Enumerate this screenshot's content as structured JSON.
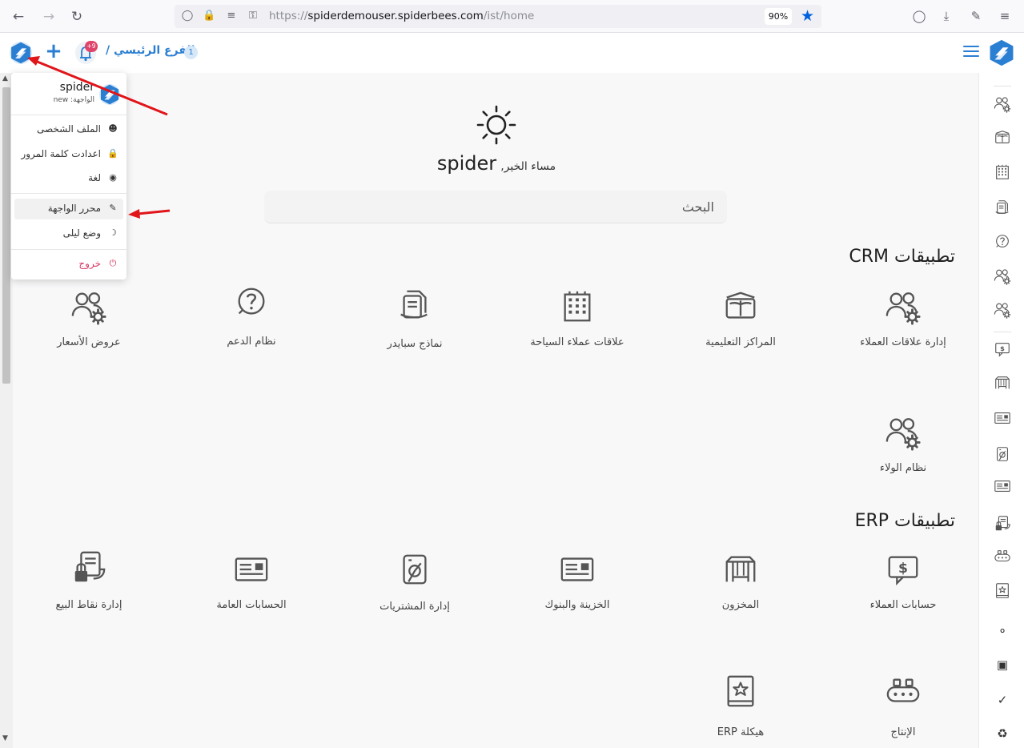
{
  "browser": {
    "url_prefix": "https://",
    "url_domain": "spiderdemouser.spiderbees.com",
    "url_path": "/ist/home",
    "zoom": "90%"
  },
  "header": {
    "branch": "الفرع الرئيسي /",
    "branch_count": "1",
    "notification_badge": "+9"
  },
  "greeting": {
    "word": "مساء الخير,",
    "name": "spider"
  },
  "search": {
    "placeholder": "البحث"
  },
  "crm": {
    "title": "تطبيقات CRM",
    "apps": [
      {
        "label": "إدارة علاقات العملاء",
        "icon": "users-gear-icon"
      },
      {
        "label": "المراكز التعليمية",
        "icon": "book-open-icon"
      },
      {
        "label": "علاقات عملاء السياحة",
        "icon": "building-icon"
      },
      {
        "label": "نماذج سبايدر",
        "icon": "forms-icon"
      },
      {
        "label": "نظام الدعم",
        "icon": "question-circle-icon"
      },
      {
        "label": "عروض الأسعار",
        "icon": "users-gear-icon"
      },
      {
        "label": "نظام الولاء",
        "icon": "users-gear-icon"
      }
    ]
  },
  "erp": {
    "title": "تطبيقات ERP",
    "apps": [
      {
        "label": "حسابات العملاء",
        "icon": "dollar-chat-icon"
      },
      {
        "label": "المخزون",
        "icon": "warehouse-icon"
      },
      {
        "label": "الخزينة والبنوك",
        "icon": "id-card-icon"
      },
      {
        "label": "إدارة المشتريات",
        "icon": "purchase-doc-icon"
      },
      {
        "label": "الحسابات العامة",
        "icon": "id-card-icon"
      },
      {
        "label": "إدارة نقاط البيع",
        "icon": "pos-lock-icon"
      },
      {
        "label": "الإنتاج",
        "icon": "production-icon"
      },
      {
        "label": "هيكلة ERP",
        "icon": "star-book-icon"
      }
    ]
  },
  "user_menu": {
    "name": "spider",
    "interface": "الواجهة: new",
    "items": [
      {
        "label": "الملف الشخصى",
        "icon": "user-icon"
      },
      {
        "label": "اعدادت كلمة المرور",
        "icon": "lock-icon"
      },
      {
        "label": "لغة",
        "icon": "globe-icon"
      },
      {
        "label": "محرر الواجهة",
        "icon": "interface-editor-icon"
      },
      {
        "label": "وضع ليلى",
        "icon": "moon-icon"
      },
      {
        "label": "خروج",
        "icon": "power-icon"
      }
    ]
  },
  "colors": {
    "accent": "#2b7fd3",
    "annotation_arrow": "#e0161b",
    "logout": "#d63864"
  }
}
